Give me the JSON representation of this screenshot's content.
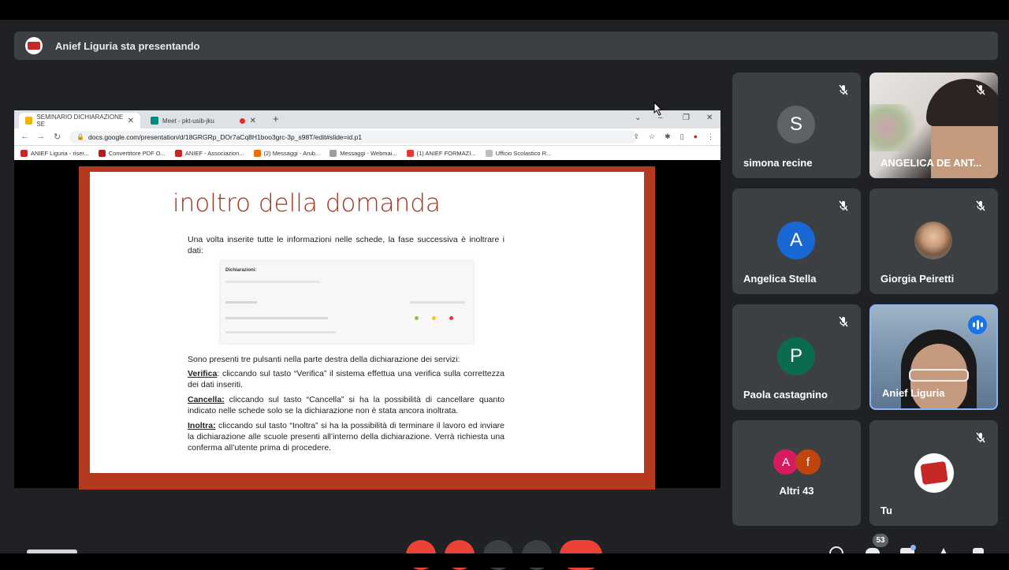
{
  "presenter_bar": {
    "title": "Anief Liguria sta presentando",
    "logo_icon": "anief-logo-icon"
  },
  "browser": {
    "tabs": [
      {
        "label": "SEMINARIO DICHIARAZIONE SE",
        "favicon": "slides-icon",
        "color": "#f4b400"
      },
      {
        "label": "Meet - pkt-usib-jku",
        "favicon": "meet-icon",
        "color": "#00897b"
      }
    ],
    "url": "docs.google.com/presentation/d/18GRGRp_DOr7aCq8H1boo3grc-3p_s98T/edit#slide=id.p1",
    "bookmarks": [
      {
        "label": "ANIEF Liguria - riser...",
        "color": "#c62828"
      },
      {
        "label": "Convertitore PDF O...",
        "color": "#b71c1c"
      },
      {
        "label": "ANIEF - Associazion...",
        "color": "#c62828"
      },
      {
        "label": "(2) Messaggi - Arub...",
        "color": "#ef6c00"
      },
      {
        "label": "Messaggi - Webmai...",
        "color": "#9e9e9e"
      },
      {
        "label": "(1) ANIEF FORMAZI...",
        "color": "#e53935"
      },
      {
        "label": "Ufficio Scolastico R...",
        "color": "#bdbdbd"
      }
    ]
  },
  "slide": {
    "title": "inoltro della domanda",
    "intro": "Una volta inserite tutte le informazioni nelle schede, la fase successiva è inoltrare i dati:",
    "embed_label": "Dichiarazioni:",
    "buttons_intro": "Sono presenti tre pulsanti nella parte destra della dichiarazione dei servizi:",
    "items": [
      {
        "term": "Verifica",
        "text": ": cliccando sul tasto “Verifica” il sistema effettua una verifica sulla correttezza dei dati inseriti."
      },
      {
        "term": "Cancella:",
        "text": " cliccando sul tasto “Cancella” si ha la possibilità di cancellare quanto indicato nelle schede solo se la dichiarazione non è stata ancora inoltrata."
      },
      {
        "term": "Inoltra:",
        "text": " cliccando sul tasto “Inoltra” si ha la possibilità di terminare il lavoro ed inviare la dichiarazione alle scuole presenti all’interno della dichiarazione. Verrà richiesta una conferma all’utente prima di procedere."
      }
    ]
  },
  "participants": [
    {
      "name": "simona recine",
      "initial": "S",
      "color": "#5f6368",
      "muted": true
    },
    {
      "name": "ANGELICA DE ANT...",
      "video": true,
      "muted": true
    },
    {
      "name": "Angelica Stella",
      "initial": "A",
      "color": "#1967d2",
      "muted": true
    },
    {
      "name": "Giorgia Peiretti",
      "photo": true,
      "muted": true
    },
    {
      "name": "Paola castagnino",
      "initial": "P",
      "color": "#0b6b4f",
      "muted": true
    },
    {
      "name": "Anief Liguria",
      "video": true,
      "speaking": true
    },
    {
      "name": "Altri 43",
      "initials": [
        "A",
        "f"
      ]
    },
    {
      "name": "Tu",
      "logo": true,
      "muted": true
    }
  ],
  "bottom": {
    "participant_count": "53"
  }
}
